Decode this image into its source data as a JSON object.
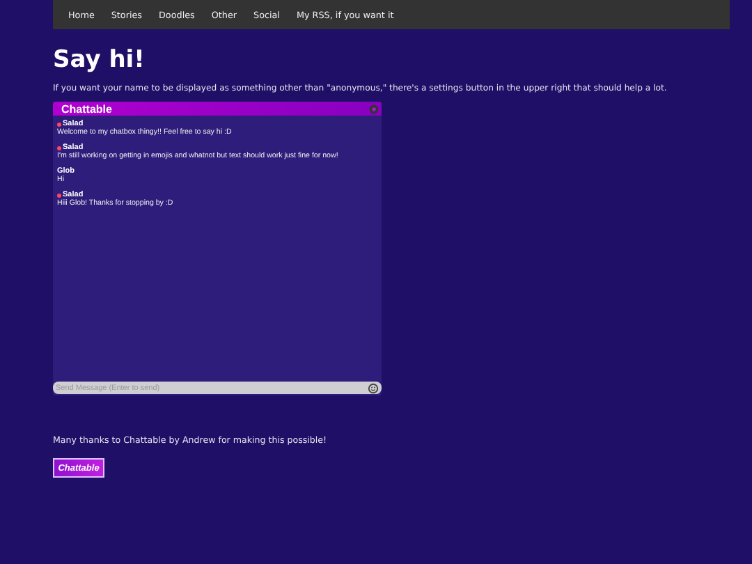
{
  "nav": [
    "Home",
    "Stories",
    "Doodles",
    "Other",
    "Social",
    "My RSS, if you want it"
  ],
  "title": "Say hi!",
  "intro": "If you want your name to be displayed as something other than \"anonymous,\" there's a settings button in the upper right that should help a lot.",
  "chat": {
    "title": "Chattable",
    "messages": [
      {
        "author": "Salad",
        "flagged": true,
        "text": "Welcome to my chatbox thingy!! Feel free to say hi :D"
      },
      {
        "author": "Salad",
        "flagged": true,
        "text": "I'm still working on getting in emojis and whatnot but text should work just fine for now!"
      },
      {
        "author": "Glob",
        "flagged": false,
        "text": "Hi"
      },
      {
        "author": "Salad",
        "flagged": true,
        "text": "Hiii Glob! Thanks for stopping by :D"
      }
    ],
    "input": {
      "placeholder": "Send Message (Enter to send)"
    }
  },
  "thanks": "Many thanks to Chattable by Andrew for making this possible!",
  "badge": "Chattable"
}
